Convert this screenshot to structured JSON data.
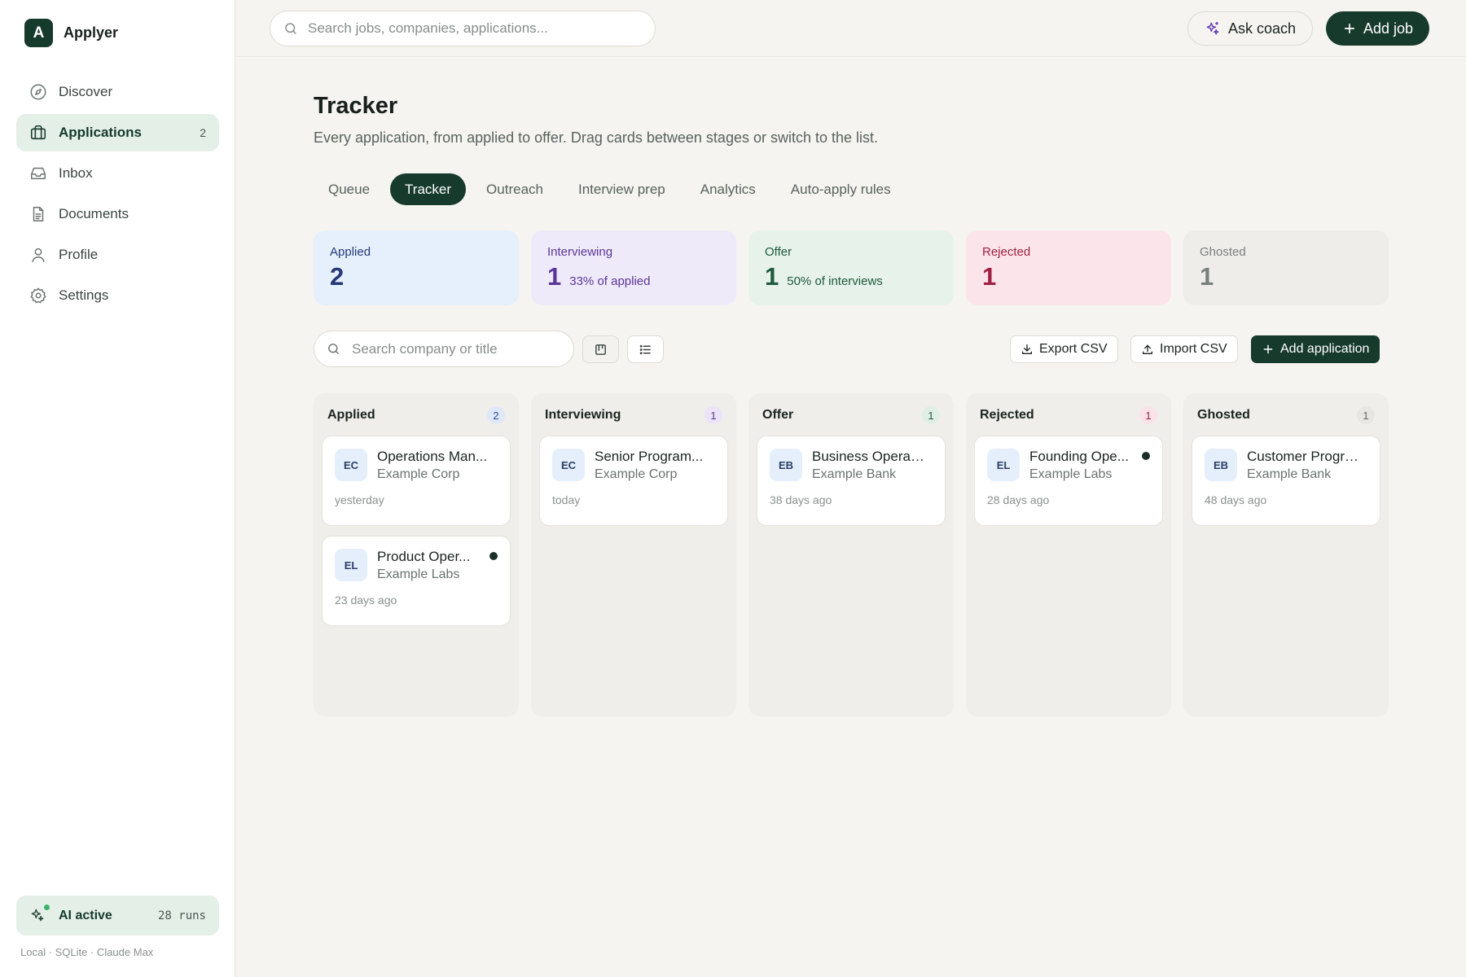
{
  "app": {
    "logo_letter": "A",
    "name": "Applyer"
  },
  "sidebar": {
    "items": [
      {
        "label": "Discover",
        "icon": "compass-icon",
        "active": false,
        "badge": ""
      },
      {
        "label": "Applications",
        "icon": "briefcase-icon",
        "active": true,
        "badge": "2"
      },
      {
        "label": "Inbox",
        "icon": "inbox-icon",
        "active": false,
        "badge": ""
      },
      {
        "label": "Documents",
        "icon": "document-icon",
        "active": false,
        "badge": ""
      },
      {
        "label": "Profile",
        "icon": "user-icon",
        "active": false,
        "badge": ""
      },
      {
        "label": "Settings",
        "icon": "gear-icon",
        "active": false,
        "badge": ""
      }
    ],
    "ai_status": {
      "label": "AI active",
      "runs": "28 runs",
      "icon": "sparkles-icon",
      "status_color": "#3bb56b"
    },
    "footer": "Local · SQLite · Claude Max"
  },
  "topbar": {
    "search_placeholder": "Search jobs, companies, applications...",
    "coach_label": "Ask coach",
    "add_job_label": "Add job"
  },
  "page": {
    "title": "Tracker",
    "subtitle": "Every application, from applied to offer. Drag cards between stages or switch to the list.",
    "tabs": [
      {
        "label": "Queue",
        "active": false
      },
      {
        "label": "Tracker",
        "active": true
      },
      {
        "label": "Outreach",
        "active": false
      },
      {
        "label": "Interview prep",
        "active": false
      },
      {
        "label": "Analytics",
        "active": false
      },
      {
        "label": "Auto-apply rules",
        "active": false
      }
    ]
  },
  "stats": [
    {
      "label": "Applied",
      "value": "2",
      "note": "",
      "bg": "#e6effc",
      "fg": "#243a78"
    },
    {
      "label": "Interviewing",
      "value": "1",
      "note": "33% of applied",
      "bg": "#efeafa",
      "fg": "#5b3597"
    },
    {
      "label": "Offer",
      "value": "1",
      "note": "50% of interviews",
      "bg": "#e6f2ea",
      "fg": "#1e5a3c"
    },
    {
      "label": "Rejected",
      "value": "1",
      "note": "",
      "bg": "#fbe5ea",
      "fg": "#a11f43"
    },
    {
      "label": "Ghosted",
      "value": "1",
      "note": "",
      "bg": "#eeedea",
      "fg": "#7a7f7c"
    }
  ],
  "toolbar": {
    "search_placeholder": "Search company or title",
    "export_label": "Export CSV",
    "import_label": "Import CSV",
    "add_label": "Add application"
  },
  "board": {
    "columns": [
      {
        "title": "Applied",
        "count": "2",
        "count_bg": "#dfe8f9",
        "count_fg": "#2c4a8a",
        "cards": [
          {
            "initials": "EC",
            "title": "Operations Man...",
            "company": "Example Corp",
            "time": "yesterday",
            "unread": false
          },
          {
            "initials": "EL",
            "title": "Product Oper...",
            "company": "Example Labs",
            "time": "23 days ago",
            "unread": true
          }
        ]
      },
      {
        "title": "Interviewing",
        "count": "1",
        "count_bg": "#ebe4f8",
        "count_fg": "#5b3597",
        "cards": [
          {
            "initials": "EC",
            "title": "Senior Program...",
            "company": "Example Corp",
            "time": "today",
            "unread": false
          }
        ]
      },
      {
        "title": "Offer",
        "count": "1",
        "count_bg": "#e0efe5",
        "count_fg": "#1e5a3c",
        "cards": [
          {
            "initials": "EB",
            "title": "Business Operati...",
            "company": "Example Bank",
            "time": "38 days ago",
            "unread": false
          }
        ]
      },
      {
        "title": "Rejected",
        "count": "1",
        "count_bg": "#fbe2e8",
        "count_fg": "#a11f43",
        "cards": [
          {
            "initials": "EL",
            "title": "Founding Ope...",
            "company": "Example Labs",
            "time": "28 days ago",
            "unread": true
          }
        ]
      },
      {
        "title": "Ghosted",
        "count": "1",
        "count_bg": "#e7e6e2",
        "count_fg": "#5f6561",
        "cards": [
          {
            "initials": "EB",
            "title": "Customer Progra...",
            "company": "Example Bank",
            "time": "48 days ago",
            "unread": false
          }
        ]
      }
    ]
  }
}
